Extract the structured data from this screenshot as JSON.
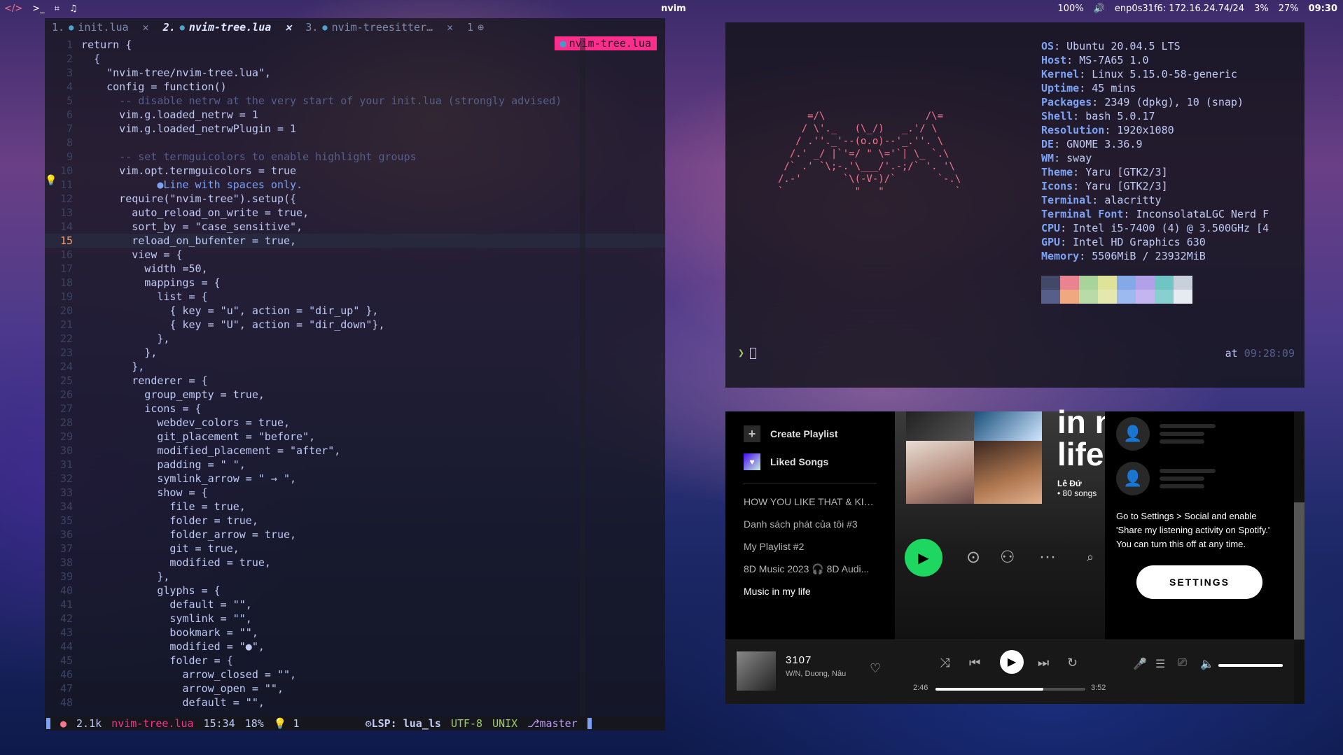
{
  "topbar": {
    "workspaces": [
      "</>",
      ">_",
      "⌗",
      "♫"
    ],
    "window_title": "nvim",
    "status": [
      "100%",
      "🔊",
      "enp0s31f6: 172.16.24.74/24",
      "3%",
      "27%"
    ],
    "clock": "09:30"
  },
  "nvim": {
    "tabs": [
      {
        "index": "1.",
        "name": "init.lua",
        "active": false,
        "close": "✕"
      },
      {
        "index": "2.",
        "name": "nvim-tree.lua",
        "active": true,
        "close": "✕"
      },
      {
        "index": "3.",
        "name": "nvim-treesitter…",
        "active": false,
        "close": "✕"
      }
    ],
    "tab_count": "1",
    "badge_file": "nvim-tree.lua",
    "cursor_line": 15,
    "lines": [
      "return {",
      "  {",
      "    \"nvim-tree/nvim-tree.lua\",",
      "    config = function()",
      "      -- disable netrw at the very start of your init.lua (strongly advised)",
      "      vim.g.loaded_netrw = 1",
      "      vim.g.loaded_netrwPlugin = 1",
      "",
      "      -- set termguicolors to enable highlight groups",
      "      vim.opt.termguicolors = true",
      "            ●Line with spaces only.",
      "      require(\"nvim-tree\").setup({",
      "        auto_reload_on_write = true,",
      "        sort_by = \"case_sensitive\",",
      "        reload_on_bufenter = true,",
      "        view = {",
      "          width =50,",
      "          mappings = {",
      "            list = {",
      "              { key = \"u\", action = \"dir_up\" },",
      "              { key = \"U\", action = \"dir_down\"},",
      "            },",
      "          },",
      "        },",
      "        renderer = {",
      "          group_empty = true,",
      "          icons = {",
      "            webdev_colors = true,",
      "            git_placement = \"before\",",
      "            modified_placement = \"after\",",
      "            padding = \" \",",
      "            symlink_arrow = \" → \",",
      "            show = {",
      "              file = true,",
      "              folder = true,",
      "              folder_arrow = true,",
      "              git = true,",
      "              modified = true,",
      "            },",
      "            glyphs = {",
      "              default = \"\",",
      "              symlink = \"\",",
      "              bookmark = \"\",",
      "              modified = \"●\",",
      "              folder = {",
      "                arrow_closed = \"\",",
      "                arrow_open = \"\",",
      "                default = \"\","
    ],
    "statusline": {
      "size": "2.1k",
      "file": "nvim-tree.lua",
      "pos": "15:34",
      "percent": "18%",
      "diag": "1",
      "lsp": "LSP: lua_ls",
      "encoding": "UTF-8",
      "format": "UNIX",
      "branch": "master"
    }
  },
  "terminal": {
    "ascii_art": "     =/\\                 /\\=\n    / \\'._   (\\_/)   _.'/ \\\n   / .''._'--(o.o)--'_.''. \\\n  /.' _/ |`'=/ \" \\='`| \\_ `.\\\n /` .' `\\;-.'\\___/'.-;/` '. '\\\n/.-'       `\\(-V-)/`       `-.\\\n`            \"   \"            `",
    "info": [
      {
        "key": "OS",
        "value": "Ubuntu 20.04.5 LTS"
      },
      {
        "key": "Host",
        "value": "MS-7A65 1.0"
      },
      {
        "key": "Kernel",
        "value": "Linux 5.15.0-58-generic"
      },
      {
        "key": "Uptime",
        "value": "45 mins"
      },
      {
        "key": "Packages",
        "value": "2349 (dpkg), 10 (snap)"
      },
      {
        "key": "Shell",
        "value": "bash 5.0.17"
      },
      {
        "key": "Resolution",
        "value": "1920x1080"
      },
      {
        "key": "DE",
        "value": "GNOME 3.36.9"
      },
      {
        "key": "WM",
        "value": "sway"
      },
      {
        "key": "Theme",
        "value": "Yaru [GTK2/3]"
      },
      {
        "key": "Icons",
        "value": "Yaru [GTK2/3]"
      },
      {
        "key": "Terminal",
        "value": "alacritty"
      },
      {
        "key": "Terminal Font",
        "value": "InconsolataLGC Nerd F"
      },
      {
        "key": "CPU",
        "value": "Intel i5-7400 (4) @ 3.500GHz [4"
      },
      {
        "key": "GPU",
        "value": "Intel HD Graphics 630"
      },
      {
        "key": "Memory",
        "value": "5506MiB / 23932MiB"
      }
    ],
    "palette_top": [
      "#414868",
      "#e8838f",
      "#a8d39a",
      "#dfe39a",
      "#84a8e8",
      "#b2a0e8",
      "#6fc4c4",
      "#c8d0dc"
    ],
    "palette_bottom": [
      "#565f89",
      "#f0a880",
      "#b8dba8",
      "#e5e8ae",
      "#9cbaf0",
      "#c4b4f0",
      "#88d0d0",
      "#e6ebf2"
    ],
    "prompt": "❯",
    "timestamp_label": "at",
    "timestamp": "09:28:09"
  },
  "spotify": {
    "create_playlist": "Create Playlist",
    "liked_songs": "Liked Songs",
    "playlists": [
      {
        "name": "HOW YOU LIKE THAT & KIL...",
        "active": false
      },
      {
        "name": "Danh sách phát của tôi #3",
        "active": false
      },
      {
        "name": "My Playlist #2",
        "active": false
      },
      {
        "name": "8D Music 2023 🎧 8D Audi...",
        "active": false
      },
      {
        "name": "Music in my life",
        "active": true
      }
    ],
    "big_title": "in n\nlife",
    "owner": "Lê Đứ",
    "song_count": "• 80 songs",
    "friend_text": "Go to Settings > Social and enable 'Share my listening activity on Spotify.' You can turn this off at any time.",
    "settings_button": "SETTINGS",
    "now_playing": {
      "title": "3107",
      "artist": "W/N, Duong, Nâu",
      "elapsed": "2:46",
      "total": "3:52",
      "progress": 0.72,
      "volume": 1.0
    }
  }
}
